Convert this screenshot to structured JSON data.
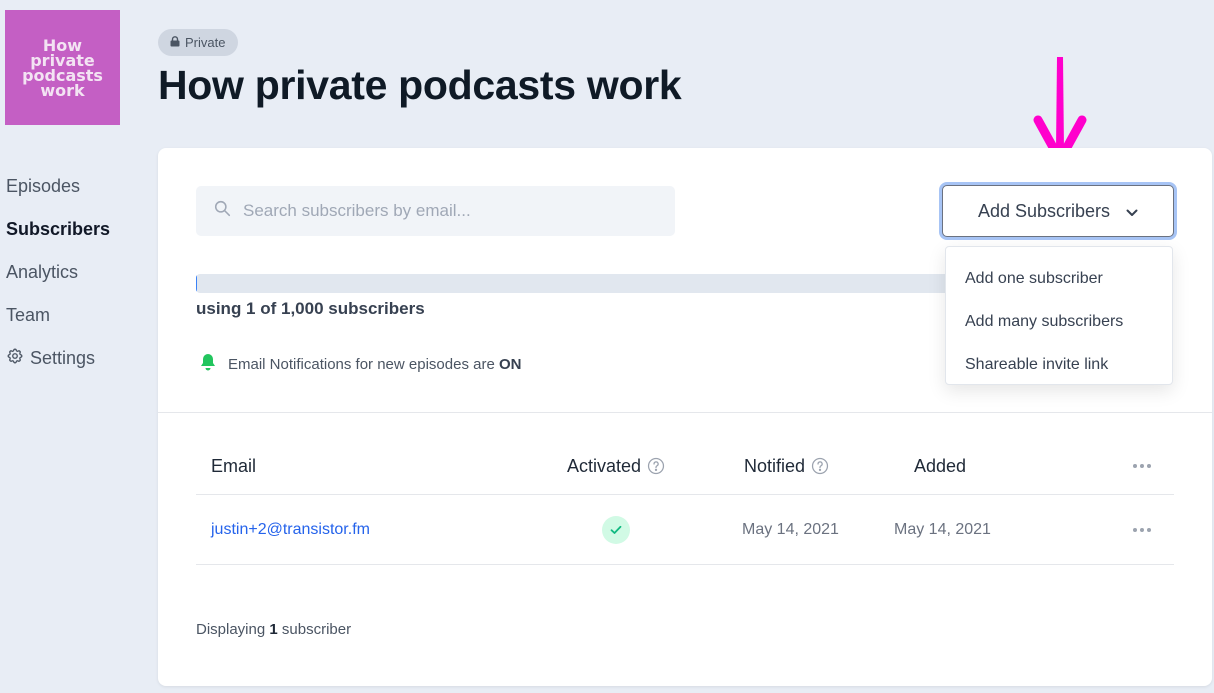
{
  "podcast": {
    "cover_text": "How\nprivate\npodcasts\nwork",
    "cover_color": "#c45fc4",
    "visibility_badge": "Private",
    "title": "How private podcasts work"
  },
  "sidebar": {
    "items": [
      {
        "label": "Episodes",
        "active": false
      },
      {
        "label": "Subscribers",
        "active": true
      },
      {
        "label": "Analytics",
        "active": false
      },
      {
        "label": "Team",
        "active": false
      },
      {
        "label": "Settings",
        "active": false,
        "icon": "gear-icon"
      }
    ]
  },
  "search": {
    "placeholder": "Search subscribers by email...",
    "value": ""
  },
  "add_subscribers": {
    "label": "Add Subscribers",
    "menu": [
      "Add one subscriber",
      "Add many subscribers",
      "Shareable invite link"
    ]
  },
  "usage": {
    "used": 1,
    "limit": 1000,
    "fraction": 0.001,
    "label": "using 1 of 1,000 subscribers"
  },
  "notifications": {
    "prefix": "Email Notifications for new episodes are ",
    "state": "ON"
  },
  "table": {
    "headers": {
      "email": "Email",
      "activated": "Activated",
      "notified": "Notified",
      "added": "Added"
    },
    "rows": [
      {
        "email": "justin+2@transistor.fm",
        "activated": true,
        "notified": "May 14, 2021",
        "added": "May 14, 2021"
      }
    ]
  },
  "footer": {
    "prefix": "Displaying ",
    "count": "1",
    "suffix": " subscriber"
  },
  "colors": {
    "accent": "#2563eb",
    "annotation_arrow": "#ff00cc",
    "notification_green": "#22c55e",
    "focus_ring": "#a7c4f5"
  }
}
